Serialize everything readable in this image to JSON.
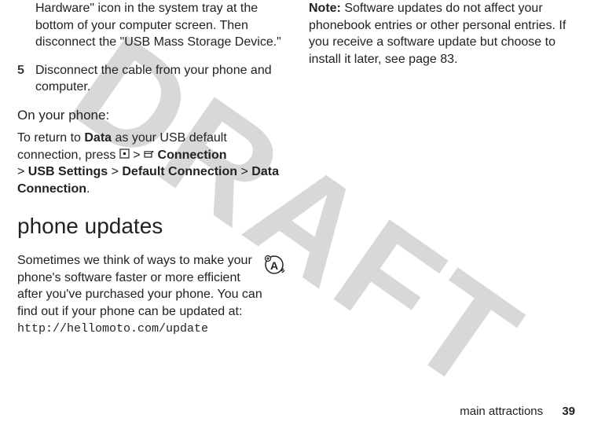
{
  "watermark": "DRAFT",
  "left": {
    "step4_text": "Hardware\" icon in the system tray at the bottom of your computer screen. Then disconnect the \"USB Mass Storage Device.\"",
    "step5_num": "5",
    "step5_text": "Disconnect the cable from your phone and computer.",
    "on_phone_heading": "On your phone:",
    "return_prefix": "To return to ",
    "data_bold": "Data",
    "return_mid": " as your USB default connection, press ",
    "gt1": " > ",
    "connection_bold": "Connection",
    "gt2": " > ",
    "usb_settings": "USB Settings",
    "gt3": " > ",
    "default_connection": "Default Connection",
    "gt4": " > ",
    "data_connection": "Data Connection",
    "period": ".",
    "phone_updates_heading": "phone updates",
    "updates_para": "Sometimes we think of ways to make your phone's software faster or more efficient after you've purchased your phone. You can find out if your phone can be updated at: ",
    "update_url": "http://hellomoto.com/update"
  },
  "right": {
    "note_bold": "Note:",
    "note_text": " Software updates do not affect your phonebook entries or other personal entries. If you receive a software update but choose to install it later, see page 83."
  },
  "footer": {
    "section": "main attractions",
    "page": "39"
  }
}
